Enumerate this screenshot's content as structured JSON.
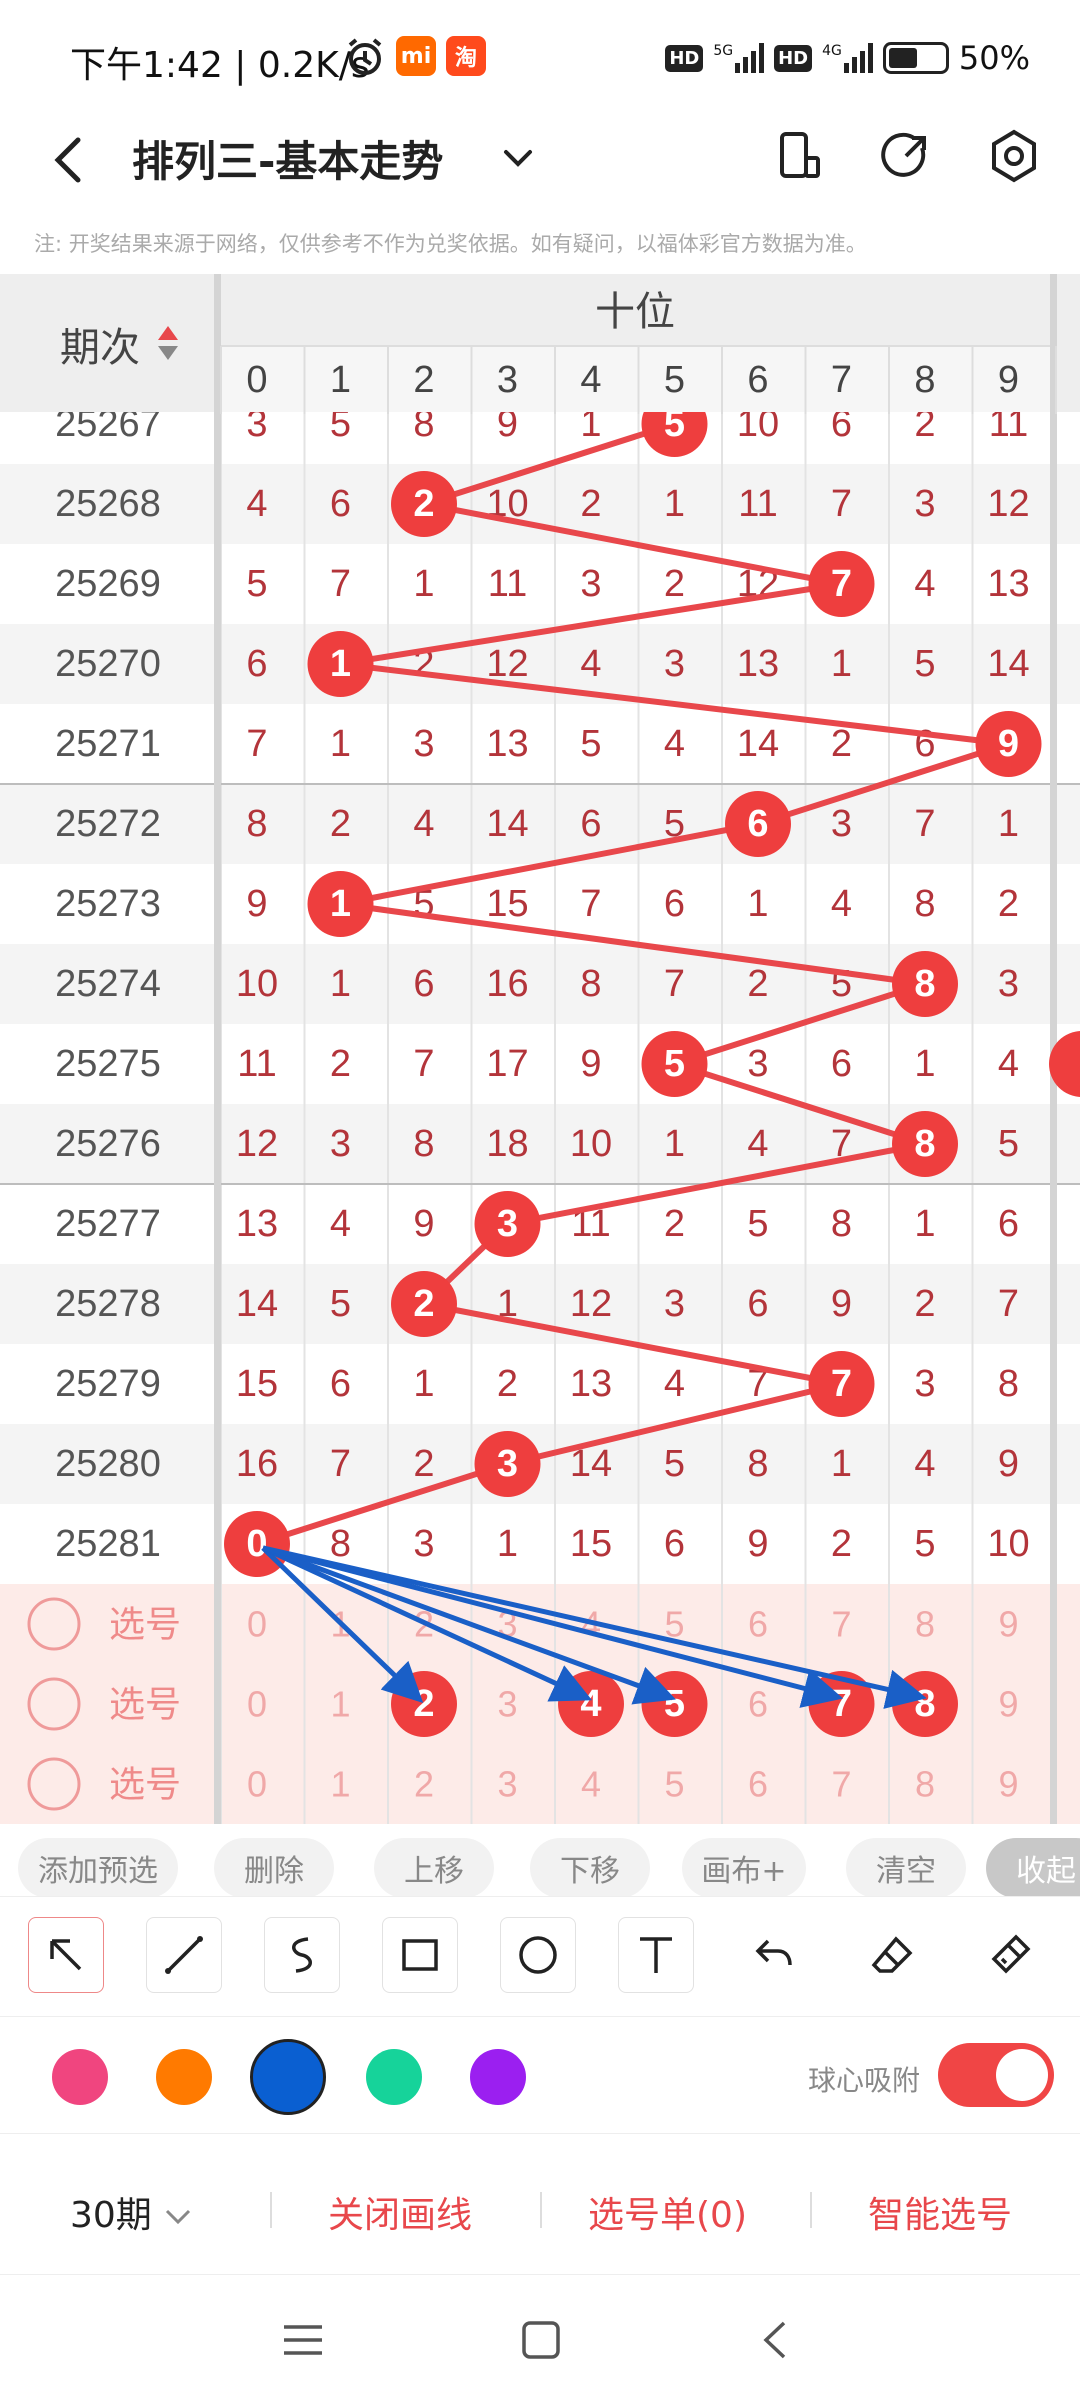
{
  "status_bar": {
    "time": "下午1:42",
    "speed": "0.2K/s",
    "network": [
      "HD",
      "5G",
      "HD",
      "4G"
    ],
    "battery": "50%",
    "icons": [
      "alarm-icon",
      "mi-icon",
      "taobao-icon"
    ]
  },
  "app_bar": {
    "title": "排列三-基本走势",
    "icons": [
      "back-icon",
      "dropdown-icon",
      "phone-icon",
      "share-icon",
      "settings-icon"
    ]
  },
  "note": "注: 开奖结果来源于网络，仅供参考不作为兑奖依据。如有疑问，以福体彩官方数据为准。",
  "table": {
    "period_header": "期次",
    "section_header": "十位",
    "digits": [
      "0",
      "1",
      "2",
      "3",
      "4",
      "5",
      "6",
      "7",
      "8",
      "9"
    ],
    "rows": [
      {
        "period": "25267",
        "cells": [
          "3",
          "5",
          "8",
          "9",
          "1",
          "5",
          "10",
          "6",
          "2",
          "11"
        ],
        "hit": 5
      },
      {
        "period": "25268",
        "cells": [
          "4",
          "6",
          "2",
          "10",
          "2",
          "1",
          "11",
          "7",
          "3",
          "12"
        ],
        "hit": 2
      },
      {
        "period": "25269",
        "cells": [
          "5",
          "7",
          "1",
          "11",
          "3",
          "2",
          "12",
          "7",
          "4",
          "13"
        ],
        "hit": 7
      },
      {
        "period": "25270",
        "cells": [
          "6",
          "1",
          "2",
          "12",
          "4",
          "3",
          "13",
          "1",
          "5",
          "14"
        ],
        "hit": 1
      },
      {
        "period": "25271",
        "cells": [
          "7",
          "1",
          "3",
          "13",
          "5",
          "4",
          "14",
          "2",
          "6",
          "9"
        ],
        "hit": 9
      },
      {
        "period": "25272",
        "cells": [
          "8",
          "2",
          "4",
          "14",
          "6",
          "5",
          "6",
          "3",
          "7",
          "1"
        ],
        "hit": 6
      },
      {
        "period": "25273",
        "cells": [
          "9",
          "1",
          "5",
          "15",
          "7",
          "6",
          "1",
          "4",
          "8",
          "2"
        ],
        "hit": 1
      },
      {
        "period": "25274",
        "cells": [
          "10",
          "1",
          "6",
          "16",
          "8",
          "7",
          "2",
          "5",
          "8",
          "3"
        ],
        "hit": 8
      },
      {
        "period": "25275",
        "cells": [
          "11",
          "2",
          "7",
          "17",
          "9",
          "5",
          "3",
          "6",
          "1",
          "4"
        ],
        "hit": 5
      },
      {
        "period": "25276",
        "cells": [
          "12",
          "3",
          "8",
          "18",
          "10",
          "1",
          "4",
          "7",
          "8",
          "5"
        ],
        "hit": 8
      },
      {
        "period": "25277",
        "cells": [
          "13",
          "4",
          "9",
          "3",
          "11",
          "2",
          "5",
          "8",
          "1",
          "6"
        ],
        "hit": 3
      },
      {
        "period": "25278",
        "cells": [
          "14",
          "5",
          "2",
          "1",
          "12",
          "3",
          "6",
          "9",
          "2",
          "7"
        ],
        "hit": 2
      },
      {
        "period": "25279",
        "cells": [
          "15",
          "6",
          "1",
          "2",
          "13",
          "4",
          "7",
          "7",
          "3",
          "8"
        ],
        "hit": 7
      },
      {
        "period": "25280",
        "cells": [
          "16",
          "7",
          "2",
          "3",
          "14",
          "5",
          "8",
          "1",
          "4",
          "9"
        ],
        "hit": 3
      },
      {
        "period": "25281",
        "cells": [
          "0",
          "8",
          "3",
          "1",
          "15",
          "6",
          "9",
          "2",
          "5",
          "10"
        ],
        "hit": 0
      }
    ],
    "pick_rows": [
      {
        "label": "选号",
        "selected": []
      },
      {
        "label": "选号",
        "selected": [
          2,
          4,
          5,
          7,
          8
        ]
      },
      {
        "label": "选号",
        "selected": []
      }
    ]
  },
  "toolbar": [
    "添加预选",
    "删除",
    "上移",
    "下移",
    "画布+",
    "清空",
    "收起"
  ],
  "drawing_tools": [
    "select-arrow-icon",
    "line-icon",
    "curve-icon",
    "rectangle-icon",
    "circle-icon",
    "text-icon",
    "undo-icon",
    "eraser-icon",
    "clear-brush-icon"
  ],
  "palette": [
    "#f0457f",
    "#ff7a00",
    "#0a5fd1",
    "#16d39a",
    "#9b1ff0"
  ],
  "snap_label": "球心吸附",
  "snap_on": true,
  "bottom": {
    "periods": "30期",
    "close_lines": "关闭画线",
    "pick_list": "选号单(0)",
    "smart_pick": "智能选号"
  },
  "colors": {
    "accent": "#f04545",
    "miss_text": "#b3343a",
    "hit_ball": "#ee3e3e",
    "line": "#e8474b",
    "arrow": "#1a5fc7",
    "pick_bg": "#fdebe8"
  }
}
